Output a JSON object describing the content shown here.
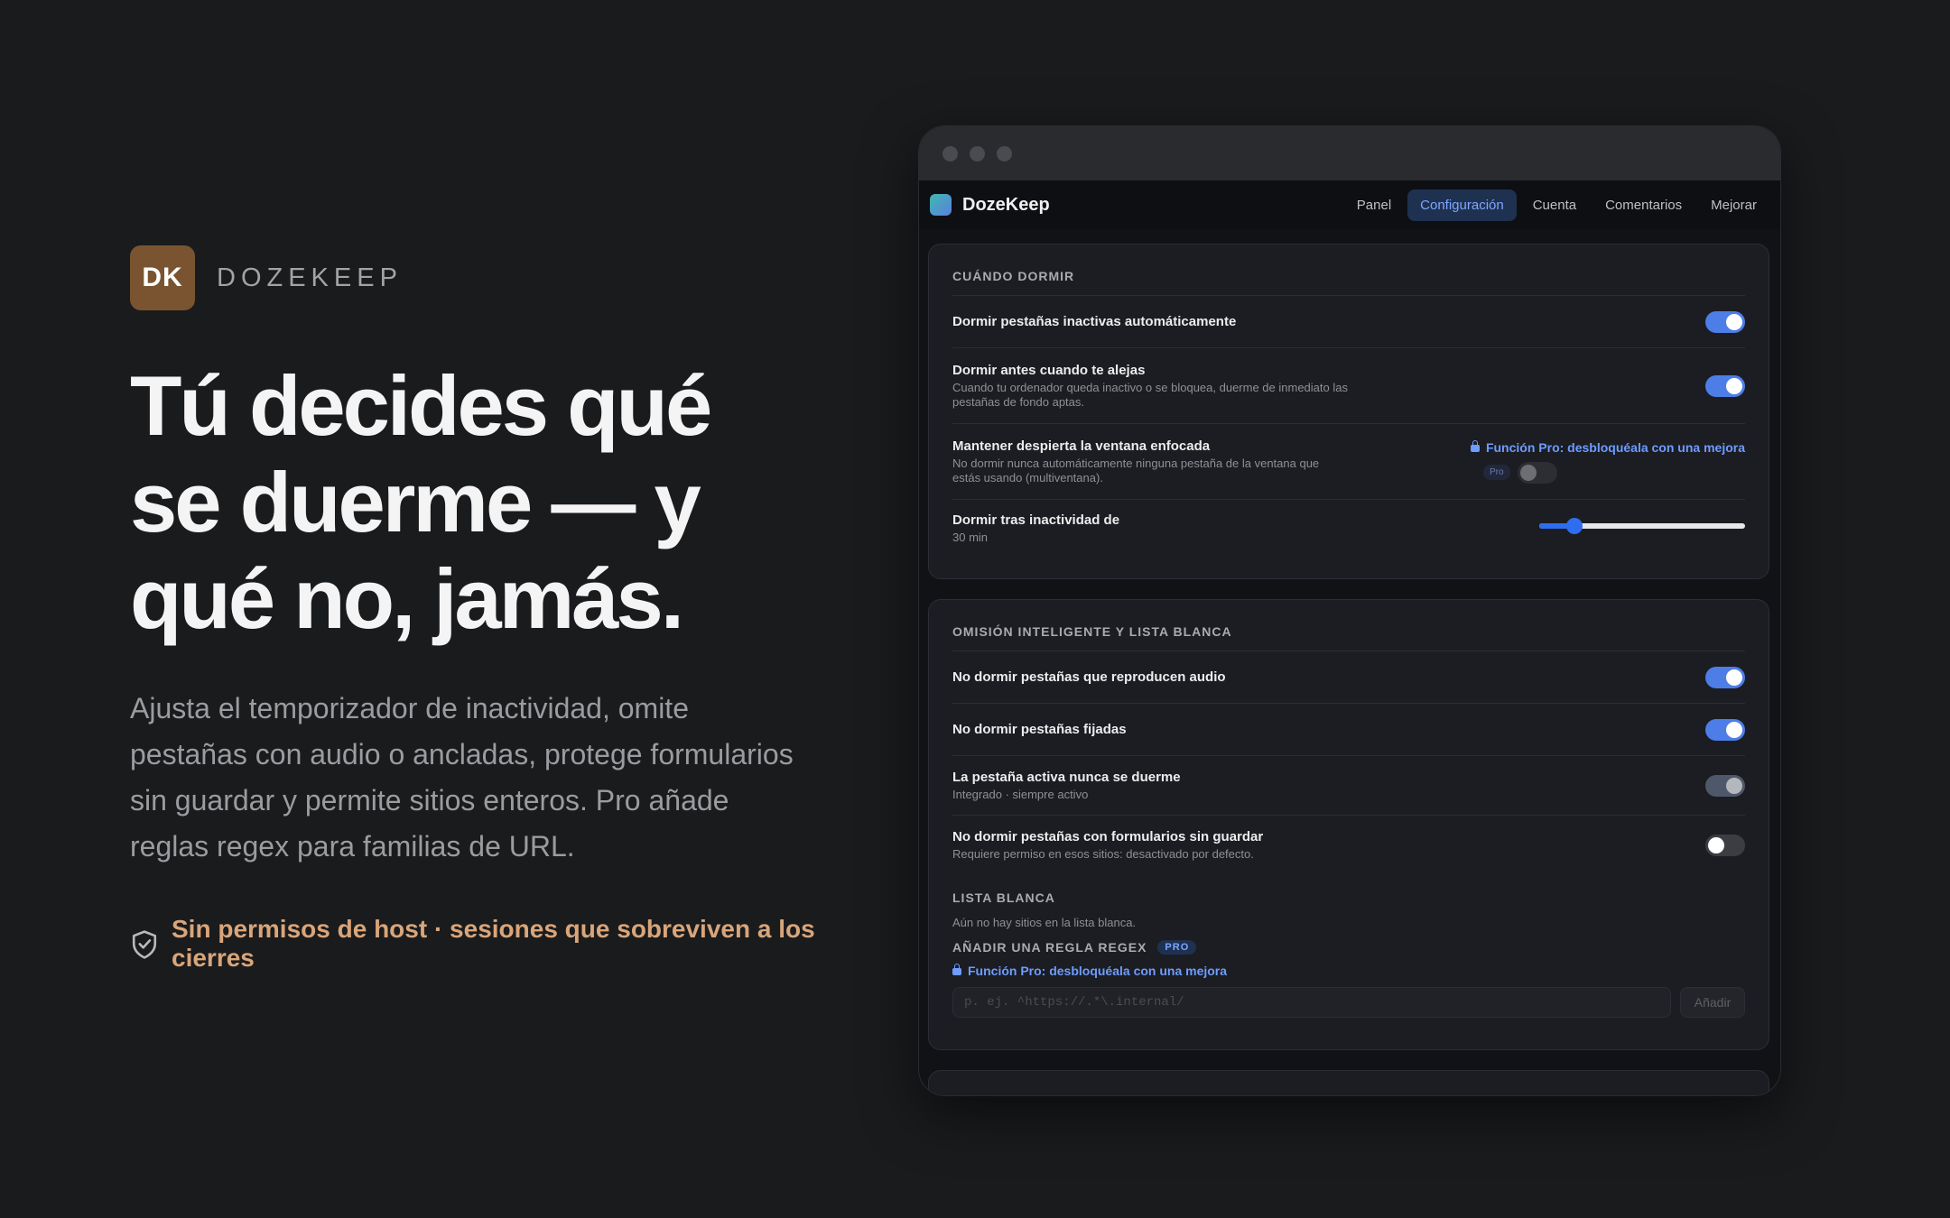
{
  "brand": {
    "logo_text": "DK",
    "name": "DOZEKEEP"
  },
  "hero": {
    "headline": "Tú decides qué se duerme — y qué no, jamás.",
    "subtext": "Ajusta el temporizador de inactividad, omite pestañas con audio o ancladas, protege formularios sin guardar y permite sitios enteros. Pro añade reglas regex para familias de URL.",
    "trust": "Sin permisos de host · sesiones que sobreviven a los cierres",
    "trust_icon": "shield-check-icon"
  },
  "app": {
    "name": "DozeKeep",
    "tabs": [
      "Panel",
      "Configuración",
      "Cuenta",
      "Comentarios",
      "Mejorar"
    ],
    "active_tab": "Configuración"
  },
  "when_to_sleep": {
    "title": "CUÁNDO DORMIR",
    "auto_sleep": {
      "label": "Dormir pestañas inactivas automáticamente",
      "enabled": true
    },
    "sleep_on_away": {
      "label": "Dormir antes cuando te alejas",
      "desc": "Cuando tu ordenador queda inactivo o se bloquea, duerme de inmediato las pestañas de fondo aptas.",
      "enabled": true
    },
    "keep_focused": {
      "label": "Mantener despierta la ventana enfocada",
      "desc": "No dormir nunca automáticamente ninguna pestaña de la ventana que estás usando (multiventana).",
      "pro_notice": "Función Pro: desbloquéala con una mejora",
      "pro_badge": "Pro",
      "enabled": false
    },
    "idle_timeout": {
      "label": "Dormir tras inactividad de",
      "value_text": "30 min",
      "level": 0.17
    }
  },
  "smart_skip": {
    "title": "OMISIÓN INTELIGENTE Y LISTA BLANCA",
    "audio": {
      "label": "No dormir pestañas que reproducen audio",
      "enabled": true
    },
    "pinned": {
      "label": "No dormir pestañas fijadas",
      "enabled": true
    },
    "active_tab": {
      "label": "La pestaña activa nunca se duerme",
      "desc": "Integrado · siempre activo",
      "enabled": true
    },
    "forms": {
      "label": "No dormir pestañas con formularios sin guardar",
      "desc": "Requiere permiso en esos sitios: desactivado por defecto.",
      "enabled": false
    },
    "whitelist": {
      "title": "LISTA BLANCA",
      "empty_text": "Aún no hay sitios en la lista blanca."
    },
    "regex": {
      "title": "AÑADIR UNA REGLA REGEX",
      "pro_badge": "PRO",
      "pro_notice": "Función Pro: desbloquéala con una mejora",
      "placeholder": "p. ej. ^https://.*\\.internal/",
      "add_label": "Añadir"
    }
  },
  "colors": {
    "accent": "#4d7ee8",
    "brand": "#7a5431",
    "trust": "#d9a57a",
    "background": "#1a1b1d"
  }
}
